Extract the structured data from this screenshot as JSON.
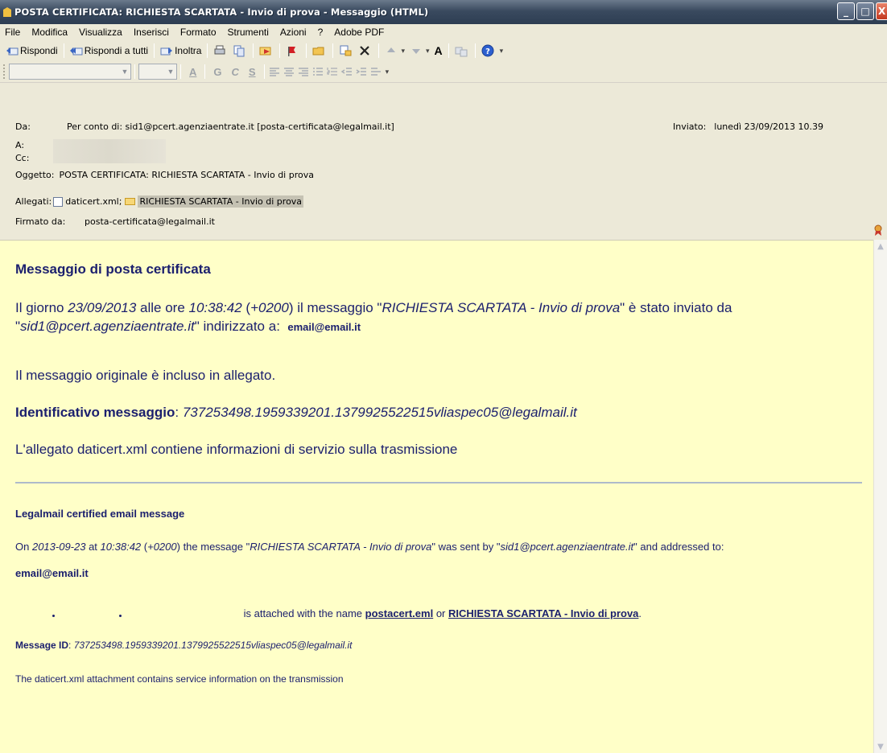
{
  "window": {
    "title": "POSTA CERTIFICATA: RICHIESTA SCARTATA - Invio di prova - Messaggio (HTML)",
    "buttons": {
      "minimize": "_",
      "maximize": "□",
      "close": "X"
    }
  },
  "menu": [
    "File",
    "Modifica",
    "Visualizza",
    "Inserisci",
    "Formato",
    "Strumenti",
    "Azioni",
    "?",
    "Adobe PDF"
  ],
  "toolbar": {
    "reply": "Rispondi",
    "reply_all": "Rispondi a tutti",
    "forward": "Inoltra",
    "font_size_glyph": "A"
  },
  "format_toolbar": {
    "glyphs": [
      "A",
      "G",
      "C",
      "S"
    ]
  },
  "header": {
    "from_label": "Da:",
    "from_value": "Per conto di: sid1@pcert.agenziaentrate.it [posta-certificata@legalmail.it]",
    "sent_label": "Inviato:",
    "sent_value": "lunedì 23/09/2013 10.39",
    "to_label": "A:",
    "cc_label": "Cc:",
    "subject_label": "Oggetto:",
    "subject_value": "POSTA CERTIFICATA: RICHIESTA SCARTATA - Invio di prova",
    "attach_label": "Allegati:",
    "attach_1": "daticert.xml;",
    "attach_2": "RICHIESTA SCARTATA - Invio di prova",
    "signed_label": "Firmato da:",
    "signed_value": "posta-certificata@legalmail.it"
  },
  "body": {
    "title": "Messaggio di posta certificata",
    "p1_a": "Il giorno ",
    "p1_date": "23/09/2013",
    "p1_b": " alle ore ",
    "p1_time": "10:38:42",
    "p1_c": " (",
    "p1_tz": "+0200",
    "p1_d": ") il messaggio \"",
    "p1_subject": "RICHIESTA SCARTATA - Invio di prova",
    "p1_e": "\" è stato inviato da \"",
    "p1_sender": "sid1@pcert.agenziaentrate.it",
    "p1_f": "\" indirizzato a:",
    "p1_recipient": "email@email.it",
    "p2": "Il messaggio originale è incluso in allegato.",
    "p3_label": "Identificativo messaggio",
    "p3_colon": ": ",
    "p3_id": "737253498.1959339201.1379925522515vliaspec05@legalmail.it",
    "p4": "L'allegato daticert.xml contiene informazioni di servizio sulla trasmissione",
    "en_title": "Legalmail certified email message",
    "en1_a": "On ",
    "en1_date": "2013-09-23",
    "en1_b": " at ",
    "en1_time": "10:38:42",
    "en1_c": " (",
    "en1_tz": "+0200",
    "en1_d": ") the message \"",
    "en1_subject": "RICHIESTA SCARTATA - Invio di prova",
    "en1_e": "\" was sent by \"",
    "en1_sender": "sid1@pcert.agenziaentrate.it",
    "en1_f": "\" and addressed to:",
    "en_recipient": "email@email.it",
    "en2_a": " is attached with the name ",
    "en2_link1": "postacert.eml",
    "en2_or": " or ",
    "en2_link2": "RICHIESTA SCARTATA - Invio di prova",
    "en2_end": ".",
    "en3_label": "Message ID",
    "en3_colon": ": ",
    "en3_id": "737253498.1959339201.1379925522515vliaspec05@legalmail.it",
    "en4": "The daticert.xml attachment contains service information on the transmission"
  }
}
